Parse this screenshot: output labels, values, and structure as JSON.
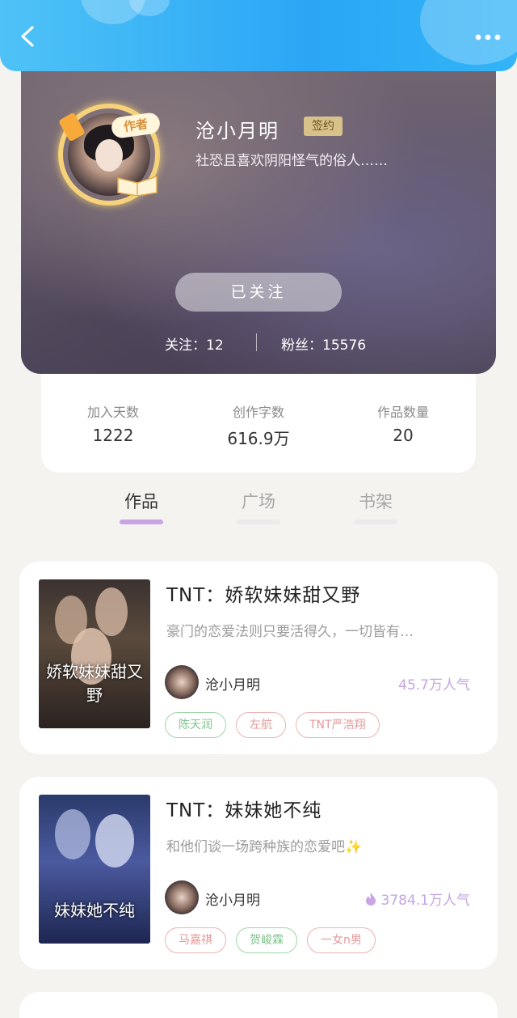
{
  "header": {
    "back_label": "",
    "more_label": ""
  },
  "profile": {
    "author_badge": "作者",
    "name": "沧小月明",
    "sign_badge": "签约",
    "bio": "社恐且喜欢阴阳怪气的俗人……",
    "follow_button": "已关注",
    "following_label": "关注：12",
    "fans_label": "粉丝：15576"
  },
  "stats": [
    {
      "label": "加入天数",
      "value": "1222"
    },
    {
      "label": "创作字数",
      "value": "616.9万"
    },
    {
      "label": "作品数量",
      "value": "20"
    }
  ],
  "tabs": [
    {
      "label": "作品",
      "active": true
    },
    {
      "label": "广场",
      "active": false
    },
    {
      "label": "书架",
      "active": false
    }
  ],
  "books": [
    {
      "cover_text": "娇软妹妹甜又野",
      "title": "TNT：娇软妹妹甜又野",
      "desc": "豪门的恋爱法则只要活得久，一切皆有…",
      "author": "沧小月明",
      "popularity": "45.7万人气",
      "tags": [
        {
          "text": "陈天润",
          "color": "green"
        },
        {
          "text": "左航",
          "color": "red"
        },
        {
          "text": "TNT严浩翔",
          "color": "red"
        }
      ]
    },
    {
      "cover_text": "妹妹她不纯",
      "title": "TNT：妹妹她不纯",
      "desc": "和他们谈一场跨种族的恋爱吧✨",
      "author": "沧小月明",
      "popularity": "3784.1万人气",
      "tags": [
        {
          "text": "马嘉祺",
          "color": "red"
        },
        {
          "text": "贺峻霖",
          "color": "green"
        },
        {
          "text": "一女n男",
          "color": "red"
        }
      ]
    }
  ],
  "colors": {
    "header": "#2aa6f5",
    "accent": "#c9a5e3",
    "popularity": "#c5a6e2"
  }
}
